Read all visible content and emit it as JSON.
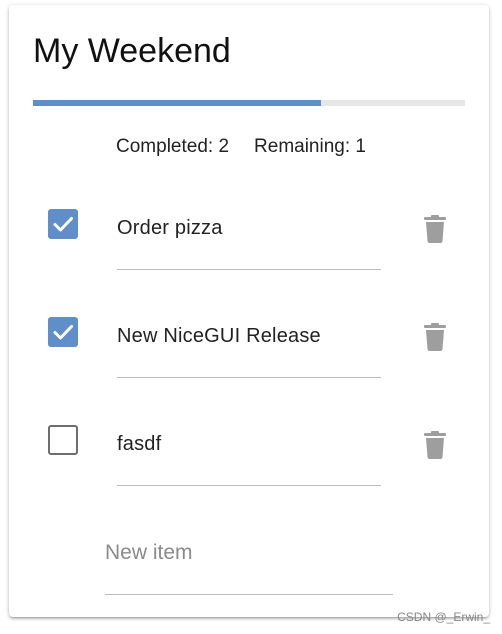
{
  "app": {
    "title": "My Weekend",
    "progress_fraction": 0.667
  },
  "colors": {
    "accent": "#5f8ec9",
    "trash": "#9e9e9e",
    "track": "#e6e6e6"
  },
  "stats": {
    "completed_label": "Completed: 2",
    "remaining_label": "Remaining: 1"
  },
  "todos": [
    {
      "label": "Order pizza",
      "done": true
    },
    {
      "label": "New NiceGUI Release",
      "done": true
    },
    {
      "label": "fasdf",
      "done": false
    }
  ],
  "new_item": {
    "placeholder": "New item",
    "value": ""
  },
  "icons": {
    "check": "check-icon",
    "delete": "trash-icon"
  },
  "watermark": "CSDN @_Erwin_"
}
